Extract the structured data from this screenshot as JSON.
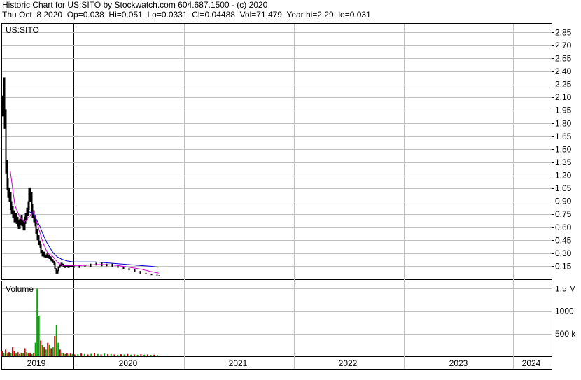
{
  "header": {
    "title_line": "Historic Chart for US:SITO by Stockwatch.com 604.687.1500 - (c) 2020",
    "quote_line": "Thu Oct  8 2020  Op=0.038  Hi=0.051  Lo=0.0331  Cl=0.04488  Vol=71,479  Year hi=2.29  lo=0.031"
  },
  "price_panel": {
    "symbol_label": "US:SITO"
  },
  "volume_panel": {
    "label": "Volume"
  },
  "colors": {
    "price_bars": "#000000",
    "ma_short": "#cc00cc",
    "ma_long": "#0000cc",
    "volume_up": "#00aa00",
    "volume_down": "#cc0000",
    "grid": "#c0c0c0"
  },
  "chart_data": [
    {
      "type": "line",
      "title": "Historic Chart for US:SITO",
      "series_note": "daily high-low bars with two moving averages",
      "y_axis": {
        "ticks": [
          "2.85",
          "2.70",
          "2.55",
          "2.40",
          "2.25",
          "2.10",
          "1.95",
          "1.80",
          "1.65",
          "1.50",
          "1.35",
          "1.20",
          "1.05",
          "0.90",
          "0.75",
          "0.60",
          "0.45",
          "0.30",
          "0.15"
        ],
        "range": [
          0,
          2.95
        ]
      },
      "x_axis": {
        "labels": [
          "2019",
          "2020",
          "2021",
          "2022",
          "2023",
          "2024"
        ],
        "year_boundaries": [
          2019.0,
          2020.0,
          2021.0,
          2022.0,
          2023.0,
          2024.0
        ]
      },
      "series": [
        {
          "kind": "price_close",
          "x": [
            2018.78,
            2018.8,
            2018.82,
            2018.84,
            2018.86,
            2018.88,
            2018.9,
            2018.92,
            2018.94,
            2018.96,
            2018.98,
            2019.0,
            2019.02,
            2019.04,
            2019.06,
            2019.08,
            2019.1,
            2019.12,
            2019.14,
            2019.16,
            2019.18,
            2019.2,
            2019.22,
            2019.24,
            2019.26,
            2019.28,
            2019.3,
            2019.32,
            2019.34,
            2019.36,
            2019.38,
            2019.4,
            2019.42,
            2019.44,
            2019.46,
            2019.48,
            2019.5,
            2019.52,
            2019.54,
            2019.56,
            2019.58,
            2019.6,
            2019.62,
            2019.64,
            2019.66,
            2019.68,
            2019.7,
            2019.72,
            2019.74,
            2019.76,
            2019.78,
            2019.8,
            2019.82,
            2019.84,
            2019.86,
            2019.88,
            2019.9,
            2019.92,
            2019.94,
            2019.96,
            2019.98,
            2020.0,
            2020.05,
            2020.1,
            2020.15,
            2020.2,
            2020.25,
            2020.3,
            2020.35,
            2020.4,
            2020.45,
            2020.5,
            2020.55,
            2020.6,
            2020.65,
            2020.7,
            2020.75,
            2020.77
          ],
          "y": [
            2.0,
            2.2,
            1.85,
            1.3,
            1.1,
            1.0,
            0.95,
            0.85,
            0.8,
            0.75,
            0.7,
            0.72,
            0.68,
            0.65,
            0.62,
            0.66,
            0.7,
            0.65,
            0.6,
            0.68,
            0.72,
            0.78,
            0.85,
            1.0,
            0.95,
            0.82,
            0.75,
            0.7,
            0.65,
            0.55,
            0.48,
            0.42,
            0.38,
            0.32,
            0.28,
            0.3,
            0.27,
            0.26,
            0.28,
            0.26,
            0.25,
            0.24,
            0.22,
            0.2,
            0.18,
            0.12,
            0.07,
            0.1,
            0.14,
            0.16,
            0.18,
            0.17,
            0.15,
            0.14,
            0.16,
            0.15,
            0.14,
            0.16,
            0.15,
            0.16,
            0.15,
            0.14,
            0.16,
            0.15,
            0.17,
            0.18,
            0.16,
            0.17,
            0.15,
            0.14,
            0.12,
            0.11,
            0.09,
            0.07,
            0.06,
            0.05,
            0.045,
            0.045
          ]
        },
        {
          "kind": "ma_short",
          "x": [
            2018.92,
            2019.0,
            2019.08,
            2019.16,
            2019.24,
            2019.32,
            2019.4,
            2019.48,
            2019.56,
            2019.64,
            2019.72,
            2019.8,
            2019.9,
            2020.0,
            2020.1,
            2020.2,
            2020.3,
            2020.4,
            2020.5,
            2020.6,
            2020.7,
            2020.77
          ],
          "y": [
            1.25,
            0.85,
            0.72,
            0.66,
            0.72,
            0.78,
            0.6,
            0.42,
            0.3,
            0.27,
            0.2,
            0.16,
            0.16,
            0.16,
            0.16,
            0.17,
            0.17,
            0.16,
            0.14,
            0.12,
            0.09,
            0.07
          ]
        },
        {
          "kind": "ma_long",
          "x": [
            2019.24,
            2019.3,
            2019.36,
            2019.42,
            2019.48,
            2019.54,
            2019.6,
            2019.66,
            2019.72,
            2019.8,
            2019.9,
            2020.0,
            2020.1,
            2020.2,
            2020.3,
            2020.4,
            2020.5,
            2020.6,
            2020.7,
            2020.77
          ],
          "y": [
            0.78,
            0.76,
            0.7,
            0.62,
            0.52,
            0.43,
            0.36,
            0.3,
            0.26,
            0.23,
            0.21,
            0.2,
            0.2,
            0.2,
            0.19,
            0.18,
            0.17,
            0.16,
            0.15,
            0.14
          ]
        }
      ]
    },
    {
      "type": "bar",
      "title": "Volume",
      "y_axis": {
        "ticks": [
          "1.5 M",
          "1000",
          "500 k"
        ],
        "range": [
          0,
          1600000
        ]
      },
      "x": [
        2018.78,
        2018.81,
        2018.84,
        2018.87,
        2018.9,
        2018.93,
        2018.96,
        2018.99,
        2019.02,
        2019.05,
        2019.08,
        2019.11,
        2019.14,
        2019.17,
        2019.2,
        2019.23,
        2019.26,
        2019.29,
        2019.32,
        2019.35,
        2019.38,
        2019.41,
        2019.44,
        2019.47,
        2019.5,
        2019.53,
        2019.56,
        2019.59,
        2019.62,
        2019.65,
        2019.68,
        2019.71,
        2019.74,
        2019.77,
        2019.8,
        2019.83,
        2019.86,
        2019.89,
        2019.92,
        2019.95,
        2019.98,
        2020.01,
        2020.04,
        2020.07,
        2020.1,
        2020.13,
        2020.16,
        2020.19,
        2020.22,
        2020.25,
        2020.28,
        2020.31,
        2020.34,
        2020.37,
        2020.4,
        2020.43,
        2020.46,
        2020.49,
        2020.52,
        2020.55,
        2020.58,
        2020.61,
        2020.64,
        2020.67,
        2020.7,
        2020.73,
        2020.76
      ],
      "values": [
        120000,
        80000,
        150000,
        60000,
        90000,
        70000,
        200000,
        110000,
        60000,
        90000,
        50000,
        80000,
        70000,
        180000,
        90000,
        60000,
        80000,
        50000,
        70000,
        300000,
        1500000,
        900000,
        350000,
        250000,
        200000,
        150000,
        300000,
        250000,
        180000,
        200000,
        450000,
        700000,
        300000,
        150000,
        80000,
        60000,
        50000,
        70000,
        40000,
        60000,
        50000,
        40000,
        45000,
        60000,
        50000,
        40000,
        55000,
        70000,
        50000,
        40000,
        60000,
        45000,
        50000,
        40000,
        35000,
        45000,
        40000,
        50000,
        35000,
        40000,
        30000,
        45000,
        35000,
        40000,
        30000,
        35000,
        25000
      ],
      "up": [
        false,
        true,
        false,
        true,
        false,
        true,
        false,
        false,
        true,
        false,
        true,
        false,
        true,
        false,
        true,
        false,
        false,
        true,
        false,
        true,
        true,
        true,
        false,
        true,
        false,
        true,
        false,
        true,
        false,
        true,
        false,
        true,
        true,
        false,
        true,
        false,
        true,
        false,
        true,
        false,
        true,
        false,
        true,
        false,
        true,
        false,
        true,
        false,
        true,
        false,
        true,
        false,
        true,
        false,
        true,
        false,
        true,
        false,
        true,
        false,
        true,
        false,
        true,
        false,
        true,
        false,
        true
      ]
    }
  ]
}
